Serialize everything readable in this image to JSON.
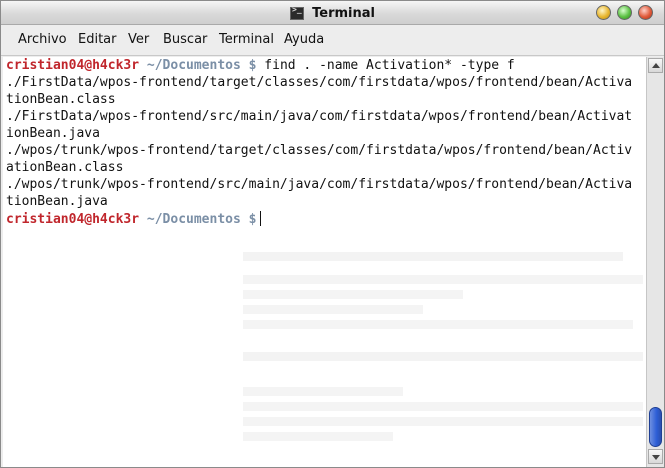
{
  "window": {
    "title": "Terminal"
  },
  "menu": [
    {
      "label": "Archivo"
    },
    {
      "label": "Editar"
    },
    {
      "label": "Ver"
    },
    {
      "label": "Buscar"
    },
    {
      "label": "Terminal"
    },
    {
      "label": "Ayuda"
    }
  ],
  "terminal": {
    "prompt1": {
      "user": "cristian04@h4ck3r",
      "path": "~/Documentos $",
      "command": "find . -name Activation* -type f"
    },
    "output": [
      "./FirstData/wpos-frontend/target/classes/com/firstdata/wpos/frontend/bean/Activa",
      "tionBean.class",
      "./FirstData/wpos-frontend/src/main/java/com/firstdata/wpos/frontend/bean/Activat",
      "ionBean.java",
      "./wpos/trunk/wpos-frontend/target/classes/com/firstdata/wpos/frontend/bean/Activ",
      "ationBean.class",
      "./wpos/trunk/wpos-frontend/src/main/java/com/firstdata/wpos/frontend/bean/Activa",
      "tionBean.java"
    ],
    "prompt2": {
      "user": "cristian04@h4ck3r",
      "path": "~/Documentos $"
    }
  },
  "scrollbar": {
    "position": 1.0
  }
}
